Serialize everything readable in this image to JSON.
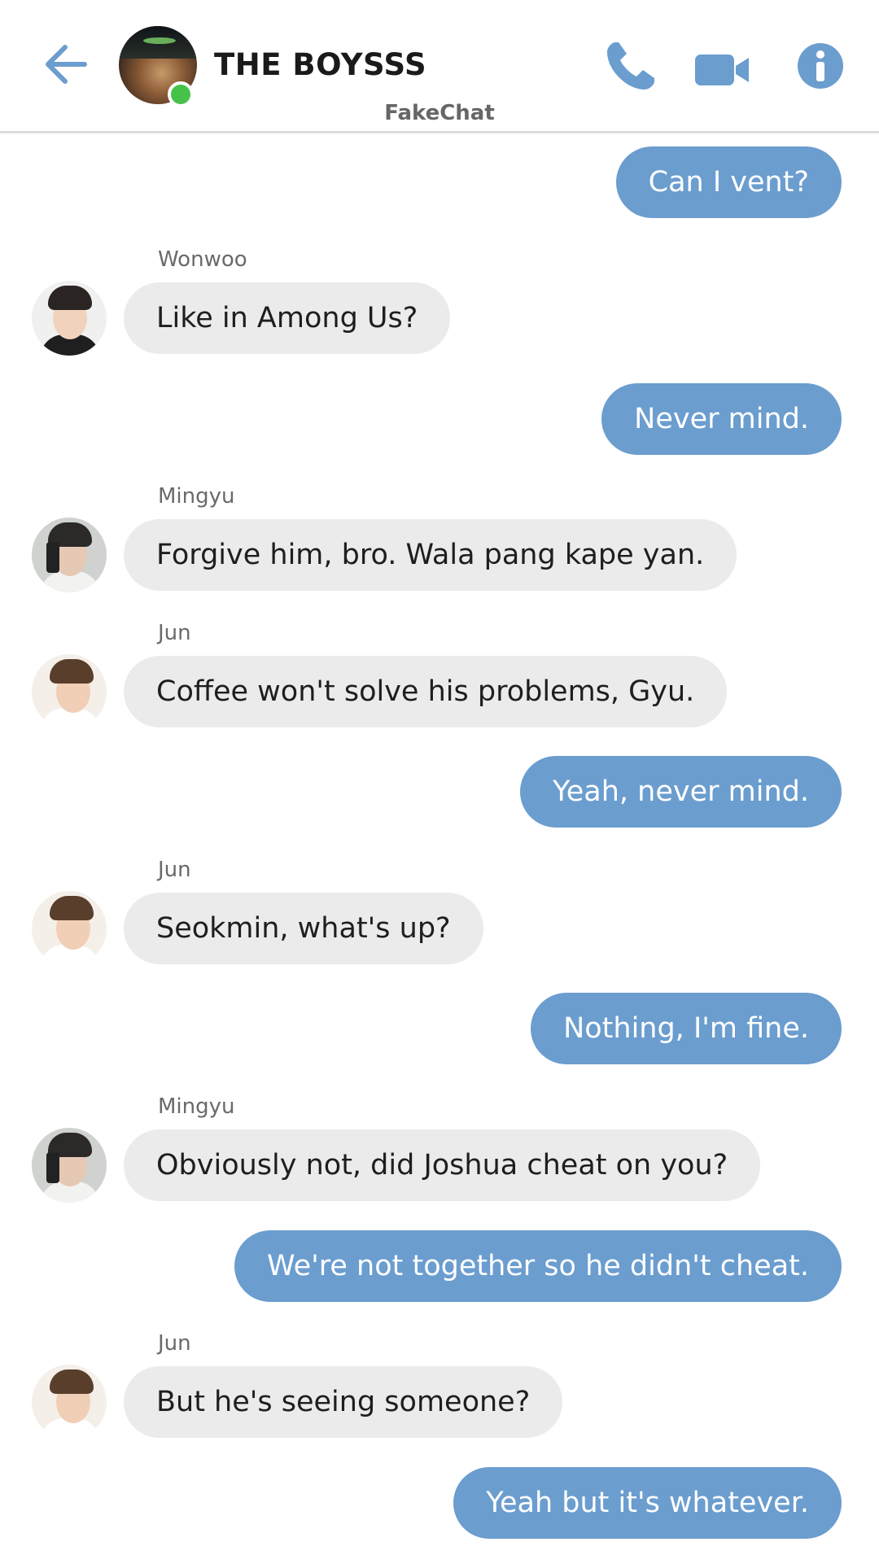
{
  "header": {
    "title": "THE BOYSSS",
    "app_name": "FakeChat",
    "back_icon": "arrow-left-icon",
    "call_icon": "phone-icon",
    "video_icon": "video-camera-icon",
    "info_icon": "info-icon",
    "accent_color": "#6b9dcf",
    "online_color": "#46c24a"
  },
  "messages": [
    {
      "type": "sent",
      "text": "Can I vent?"
    },
    {
      "type": "received",
      "sender": "Wonwoo",
      "text": "Like in Among Us?"
    },
    {
      "type": "sent",
      "text": "Never mind."
    },
    {
      "type": "received",
      "sender": "Mingyu",
      "text": "Forgive him, bro. Wala pang kape yan."
    },
    {
      "type": "received",
      "sender": "Jun",
      "text": "Coffee won't solve his problems, Gyu."
    },
    {
      "type": "sent",
      "text": "Yeah, never mind."
    },
    {
      "type": "received",
      "sender": "Jun",
      "text": "Seokmin, what's up?"
    },
    {
      "type": "sent",
      "text": "Nothing, I'm fine."
    },
    {
      "type": "received",
      "sender": "Mingyu",
      "text": "Obviously not, did Joshua cheat on you?"
    },
    {
      "type": "sent",
      "text": "We're not together so he didn't cheat."
    },
    {
      "type": "received",
      "sender": "Jun",
      "text": "But he's seeing someone?"
    },
    {
      "type": "sent",
      "text": "Yeah but it's whatever."
    }
  ],
  "colors": {
    "sent_bubble": "#6b9dcf",
    "received_bubble": "#ebebeb"
  }
}
